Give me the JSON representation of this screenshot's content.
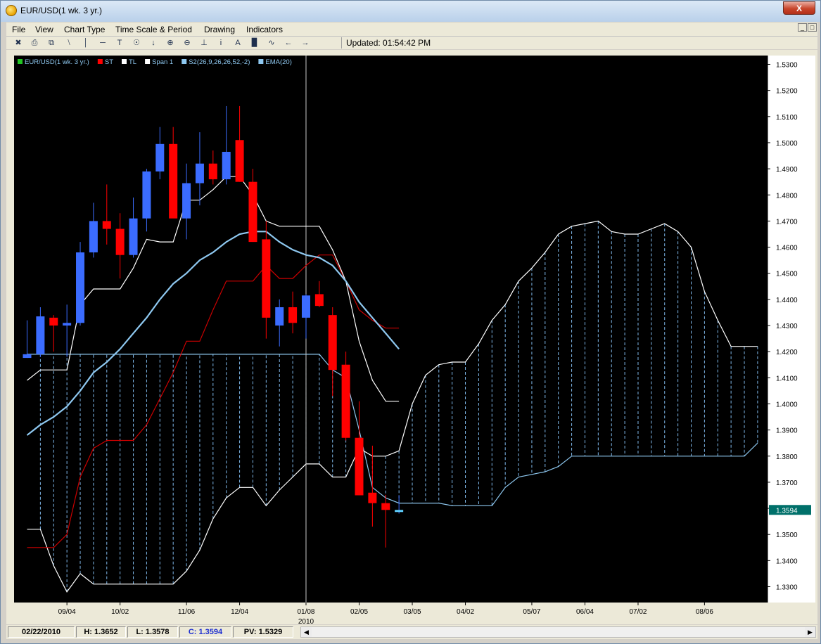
{
  "window": {
    "title": "EUR/USD(1 wk. 3 yr.)",
    "close_label": "X"
  },
  "menu": [
    "File",
    "View",
    "Chart Type",
    "Time Scale & Period",
    "Drawing",
    "Indicators"
  ],
  "toolbar": {
    "tools": [
      "cursor-icon",
      "print-icon",
      "copy-icon",
      "trendline-icon",
      "vertical-line-icon",
      "horizontal-line-icon",
      "text-icon",
      "crosshair-icon",
      "arrow-down-icon",
      "zoom-in-icon",
      "zoom-out-icon",
      "baseline-icon",
      "info-icon",
      "font-icon",
      "bar-chart-icon",
      "line-style-icon",
      "scroll-left-icon",
      "scroll-right-icon"
    ],
    "updated": "Updated: 01:54:42 PM"
  },
  "status": {
    "date": "02/22/2010",
    "high": "H: 1.3652",
    "low": "L: 1.3578",
    "close": "C: 1.3594",
    "pv": "PV: 1.5329"
  },
  "colors": {
    "background": "#000000",
    "bull": "#3b6cff",
    "bear": "#ff0000",
    "kijun": "#ffffff",
    "tenkan": "#cc0000",
    "ema": "#8ec8f0",
    "span_b": "#8ec8f0",
    "cloud_hatch": "#7fb8ea",
    "last_price_bg": "#00706a"
  },
  "chart_data": {
    "type": "candlestick",
    "legend": [
      {
        "label": "EUR/USD(1 wk. 3 yr.)",
        "color": "#22c422"
      },
      {
        "label": "ST",
        "color": "#ff0000"
      },
      {
        "label": "TL",
        "color": "#ffffff"
      },
      {
        "label": "Span 1",
        "color": "#ffffff"
      },
      {
        "label": "S2(26,9,26,26,52,-2)",
        "color": "#8ec8f0"
      },
      {
        "label": "EMA(20)",
        "color": "#8ec8f0"
      }
    ],
    "ylim": [
      1.322,
      1.535
    ],
    "yticks": [
      "1.5300",
      "1.5200",
      "1.5100",
      "1.5000",
      "1.4900",
      "1.4800",
      "1.4700",
      "1.4600",
      "1.4500",
      "1.4400",
      "1.4300",
      "1.4200",
      "1.4100",
      "1.4000",
      "1.3900",
      "1.3800",
      "1.3700",
      "1.3600",
      "1.3500",
      "1.3400",
      "1.3300"
    ],
    "xtick_labels": [
      {
        "label": "09/04",
        "index": 3
      },
      {
        "label": "10/02",
        "index": 7
      },
      {
        "label": "11/06",
        "index": 12
      },
      {
        "label": "12/04",
        "index": 16
      },
      {
        "label": "01/08",
        "index": 21
      },
      {
        "label": "02/05",
        "index": 25
      },
      {
        "label": "03/05",
        "index": 29
      },
      {
        "label": "04/02",
        "index": 33
      },
      {
        "label": "05/07",
        "index": 38
      },
      {
        "label": "06/04",
        "index": 42
      },
      {
        "label": "07/02",
        "index": 46
      },
      {
        "label": "08/06",
        "index": 51
      }
    ],
    "year_label": {
      "label": "2010",
      "index": 21
    },
    "vertical_marker_index": 21,
    "total_slots": 56,
    "candles": [
      {
        "o": 1.4176,
        "h": 1.432,
        "l": 1.4176,
        "c": 1.419
      },
      {
        "o": 1.419,
        "h": 1.437,
        "l": 1.418,
        "c": 1.4335
      },
      {
        "o": 1.433,
        "h": 1.434,
        "l": 1.42,
        "c": 1.43
      },
      {
        "o": 1.43,
        "h": 1.438,
        "l": 1.418,
        "c": 1.431
      },
      {
        "o": 1.431,
        "h": 1.462,
        "l": 1.43,
        "c": 1.458
      },
      {
        "o": 1.458,
        "h": 1.477,
        "l": 1.456,
        "c": 1.47
      },
      {
        "o": 1.47,
        "h": 1.484,
        "l": 1.461,
        "c": 1.467
      },
      {
        "o": 1.467,
        "h": 1.473,
        "l": 1.448,
        "c": 1.457
      },
      {
        "o": 1.457,
        "h": 1.479,
        "l": 1.456,
        "c": 1.471
      },
      {
        "o": 1.471,
        "h": 1.49,
        "l": 1.466,
        "c": 1.489
      },
      {
        "o": 1.489,
        "h": 1.506,
        "l": 1.486,
        "c": 1.4995
      },
      {
        "o": 1.4995,
        "h": 1.506,
        "l": 1.472,
        "c": 1.471
      },
      {
        "o": 1.471,
        "h": 1.492,
        "l": 1.463,
        "c": 1.4845
      },
      {
        "o": 1.4845,
        "h": 1.504,
        "l": 1.476,
        "c": 1.492
      },
      {
        "o": 1.492,
        "h": 1.497,
        "l": 1.484,
        "c": 1.486
      },
      {
        "o": 1.486,
        "h": 1.514,
        "l": 1.484,
        "c": 1.4965
      },
      {
        "o": 1.501,
        "h": 1.514,
        "l": 1.485,
        "c": 1.485
      },
      {
        "o": 1.485,
        "h": 1.49,
        "l": 1.462,
        "c": 1.462
      },
      {
        "o": 1.463,
        "h": 1.47,
        "l": 1.425,
        "c": 1.433
      },
      {
        "o": 1.43,
        "h": 1.44,
        "l": 1.422,
        "c": 1.437
      },
      {
        "o": 1.437,
        "h": 1.443,
        "l": 1.427,
        "c": 1.431
      },
      {
        "o": 1.433,
        "h": 1.442,
        "l": 1.425,
        "c": 1.4415
      },
      {
        "o": 1.442,
        "h": 1.447,
        "l": 1.437,
        "c": 1.4375
      },
      {
        "o": 1.434,
        "h": 1.437,
        "l": 1.403,
        "c": 1.413
      },
      {
        "o": 1.415,
        "h": 1.42,
        "l": 1.386,
        "c": 1.387
      },
      {
        "o": 1.387,
        "h": 1.401,
        "l": 1.365,
        "c": 1.365
      },
      {
        "o": 1.366,
        "h": 1.384,
        "l": 1.353,
        "c": 1.362
      },
      {
        "o": 1.362,
        "h": 1.3652,
        "l": 1.345,
        "c": 1.3594
      },
      {
        "o": 1.3594,
        "h": 1.365,
        "l": 1.358,
        "c": 1.3594
      }
    ],
    "tenkan_sen": [
      1.345,
      1.345,
      1.345,
      1.35,
      1.372,
      1.383,
      1.386,
      1.386,
      1.386,
      1.392,
      1.402,
      1.412,
      1.424,
      1.424,
      1.436,
      1.447,
      1.447,
      1.447,
      1.453,
      1.448,
      1.448,
      1.453,
      1.457,
      1.457,
      1.447,
      1.436,
      1.432,
      1.429,
      1.429
    ],
    "kijun_sen": [
      1.409,
      1.413,
      1.413,
      1.413,
      1.438,
      1.444,
      1.444,
      1.444,
      1.452,
      1.463,
      1.462,
      1.462,
      1.478,
      1.478,
      1.482,
      1.487,
      1.487,
      1.48,
      1.47,
      1.468,
      1.468,
      1.468,
      1.468,
      1.459,
      1.447,
      1.424,
      1.409,
      1.401,
      1.401
    ],
    "ema20": [
      1.388,
      1.392,
      1.395,
      1.399,
      1.405,
      1.412,
      1.416,
      1.421,
      1.427,
      1.433,
      1.44,
      1.446,
      1.45,
      1.455,
      1.458,
      1.462,
      1.465,
      1.466,
      1.466,
      1.462,
      1.459,
      1.457,
      1.456,
      1.453,
      1.447,
      1.439,
      1.433,
      1.427,
      1.421
    ],
    "senkou_span_a": [
      1.352,
      1.352,
      1.338,
      1.328,
      1.335,
      1.331,
      1.331,
      1.331,
      1.331,
      1.331,
      1.331,
      1.331,
      1.336,
      1.344,
      1.356,
      1.364,
      1.368,
      1.368,
      1.361,
      1.367,
      1.372,
      1.377,
      1.377,
      1.372,
      1.372,
      1.383,
      1.38,
      1.38,
      1.382,
      1.4,
      1.411,
      1.415,
      1.416,
      1.416,
      1.423,
      1.432,
      1.438,
      1.447,
      1.452,
      1.458,
      1.465,
      1.468,
      1.469,
      1.47,
      1.466,
      1.465,
      1.465,
      1.467,
      1.469,
      1.466,
      1.46,
      1.443,
      1.432,
      1.422,
      1.422,
      1.422
    ],
    "senkou_span_b": [
      1.419,
      1.419,
      1.419,
      1.419,
      1.419,
      1.419,
      1.419,
      1.419,
      1.419,
      1.419,
      1.419,
      1.419,
      1.419,
      1.419,
      1.419,
      1.419,
      1.419,
      1.419,
      1.419,
      1.419,
      1.419,
      1.419,
      1.419,
      1.413,
      1.41,
      1.39,
      1.368,
      1.364,
      1.362,
      1.362,
      1.362,
      1.362,
      1.361,
      1.361,
      1.361,
      1.361,
      1.368,
      1.372,
      1.373,
      1.374,
      1.376,
      1.38,
      1.38,
      1.38,
      1.38,
      1.38,
      1.38,
      1.38,
      1.38,
      1.38,
      1.38,
      1.38,
      1.38,
      1.38,
      1.38,
      1.385
    ],
    "last_price": "1.3594",
    "last_price_value": 1.3594
  }
}
